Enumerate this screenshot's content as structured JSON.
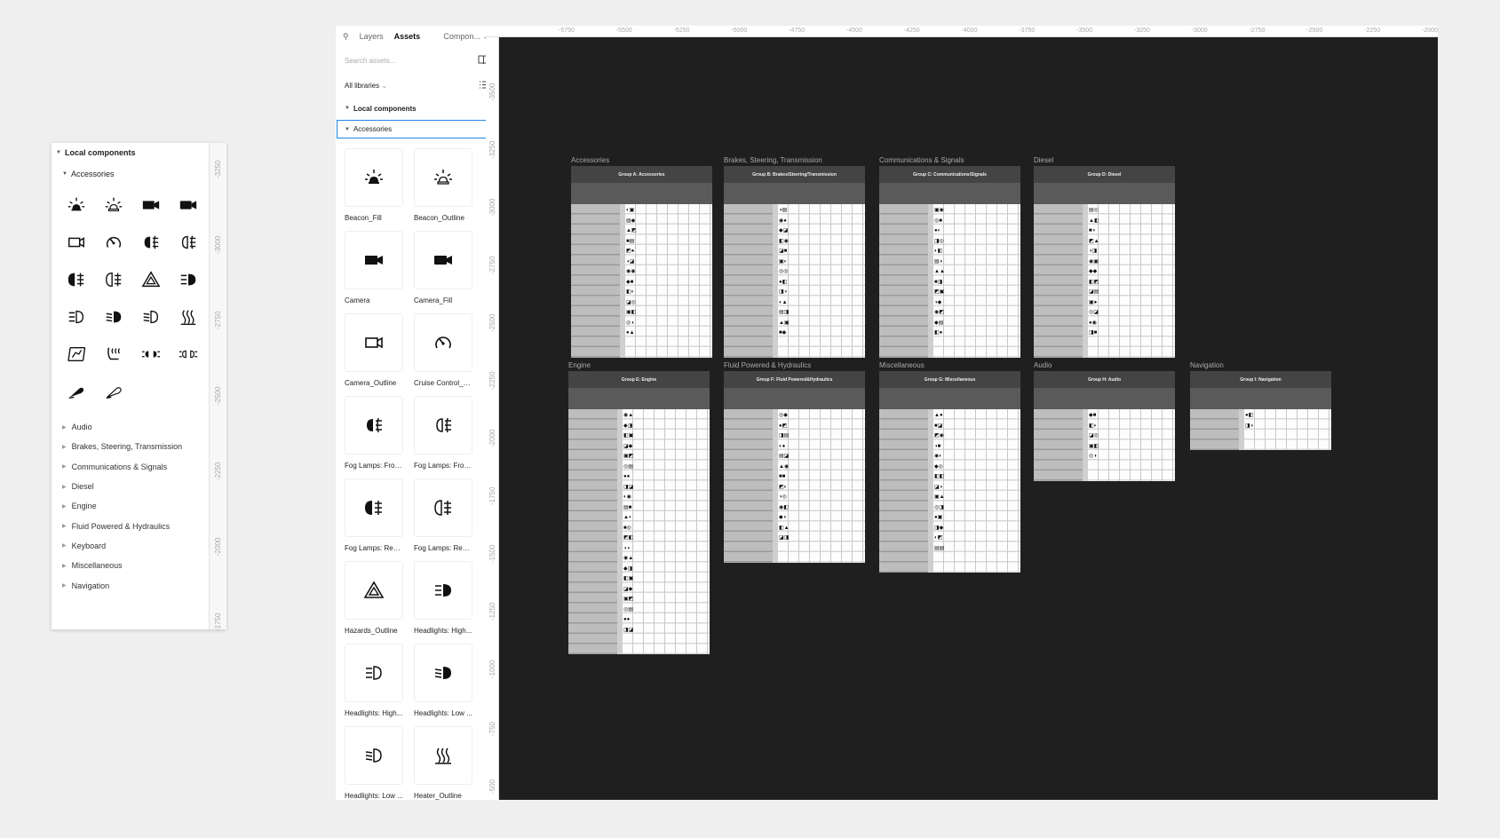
{
  "inset": {
    "title": "Local components",
    "subtitle": "Accessories",
    "ruler": [
      "-3250",
      "-3000",
      "-2750",
      "-2500",
      "-2250",
      "-2000",
      "-1750"
    ],
    "icons": [
      "beacon-fill-icon",
      "beacon-outline-icon",
      "camera-icon",
      "camera-fill-icon",
      "camera-outline-icon",
      "cruise-control-icon",
      "fog-lamp-front-fill-icon",
      "fog-lamp-front-outline-icon",
      "fog-lamp-rear-fill-icon",
      "fog-lamp-rear-outline-icon",
      "hazards-outline-icon",
      "headlights-high-fill-icon",
      "headlights-high-outline-icon",
      "headlights-low-fill-icon",
      "headlights-low-outline-icon",
      "heater-outline-icon",
      "navigation-map-icon",
      "seat-heater-icon",
      "parking-lights-icon",
      "parking-lights-outline-icon",
      "wiper-fill-icon",
      "wiper-outline-icon"
    ],
    "libraries": [
      "Audio",
      "Brakes, Steering, Transmission",
      "Communications & Signals",
      "Diesel",
      "Engine",
      "Fluid Powered & Hydraulics",
      "Keyboard",
      "Miscellaneous",
      "Navigation"
    ]
  },
  "panel": {
    "tabs": [
      "Layers",
      "Assets",
      "Compon..."
    ],
    "search_placeholder": "Search assets...",
    "libraries_label": "All libraries",
    "local": "Local components",
    "section": "Accessories",
    "assets": [
      {
        "label": "Beacon_Fill",
        "icon": "beacon-fill-icon"
      },
      {
        "label": "Beacon_Outline",
        "icon": "beacon-outline-icon"
      },
      {
        "label": "Camera",
        "icon": "camera-icon"
      },
      {
        "label": "Camera_Fill",
        "icon": "camera-fill-icon"
      },
      {
        "label": "Camera_Outline",
        "icon": "camera-outline-icon"
      },
      {
        "label": "Cruise Control_O...",
        "icon": "cruise-control-icon"
      },
      {
        "label": "Fog Lamps: Fron...",
        "icon": "fog-lamp-front-fill-icon"
      },
      {
        "label": "Fog Lamps: Fron...",
        "icon": "fog-lamp-front-outline-icon"
      },
      {
        "label": "Fog Lamps: Rear...",
        "icon": "fog-lamp-rear-fill-icon"
      },
      {
        "label": "Fog Lamps: Rear...",
        "icon": "fog-lamp-rear-outline-icon"
      },
      {
        "label": "Hazards_Outline",
        "icon": "hazards-outline-icon"
      },
      {
        "label": "Headlights: High...",
        "icon": "headlights-high-fill-icon"
      },
      {
        "label": "Headlights: High...",
        "icon": "headlights-high-outline-icon"
      },
      {
        "label": "Headlights: Low ...",
        "icon": "headlights-low-fill-icon"
      },
      {
        "label": "Headlights: Low ...",
        "icon": "headlights-low-outline-icon"
      },
      {
        "label": "Heater_Outline",
        "icon": "heater-outline-icon"
      }
    ]
  },
  "canvas": {
    "ruler_top": [
      "-5750",
      "-5500",
      "-5250",
      "-5000",
      "-4750",
      "-4500",
      "-4250",
      "-4000",
      "-3750",
      "-3500",
      "-3250",
      "-3000",
      "-2750",
      "-2500",
      "-2250",
      "-2000"
    ],
    "ruler_side": [
      "-3500",
      "-3250",
      "-3000",
      "-2750",
      "-2500",
      "-2250",
      "-2000",
      "-1750",
      "-1500",
      "-1250",
      "-1000",
      "-750",
      "-500"
    ],
    "frames": [
      {
        "title": "Accessories",
        "header": "Group A: Accessories",
        "rows": 15
      },
      {
        "title": "Brakes, Steering, Transmission",
        "header": "Group B: Brakes/Steering/Transmission",
        "rows": 15
      },
      {
        "title": "Communications & Signals",
        "header": "Group C: Communications/Signals",
        "rows": 15
      },
      {
        "title": "Diesel",
        "header": "Group D: Diesel",
        "rows": 15
      },
      {
        "title": "Engine",
        "header": "Group E: Engine",
        "rows": 24
      },
      {
        "title": "Fluid Powered & Hydraulics",
        "header": "Group F: Fluid Powered&Hydraulics",
        "rows": 15
      },
      {
        "title": "Miscellaneous",
        "header": "Group G: Miscellaneous",
        "rows": 16
      },
      {
        "title": "Audio",
        "header": "Group H: Audio",
        "rows": 7
      },
      {
        "title": "Navigation",
        "header": "Group I: Navigation",
        "rows": 4
      }
    ]
  }
}
